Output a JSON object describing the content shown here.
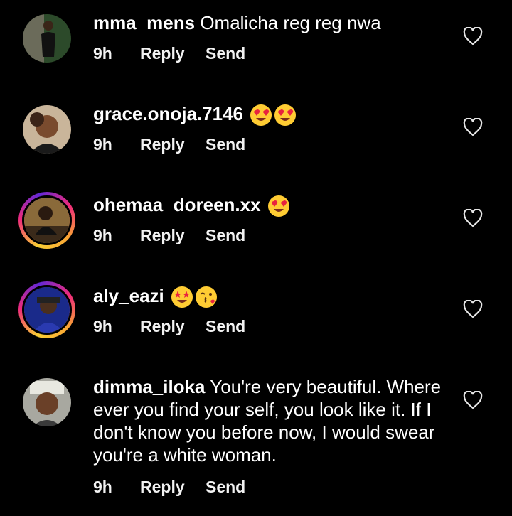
{
  "comments": [
    {
      "username": "mma_mens",
      "text": "Omalicha reg reg nwa",
      "time": "9h",
      "reply": "Reply",
      "send": "Send",
      "emoji": []
    },
    {
      "username": "grace.onoja.7146",
      "text": "",
      "time": "9h",
      "reply": "Reply",
      "send": "Send",
      "emoji": [
        "heart-eyes",
        "heart-eyes"
      ]
    },
    {
      "username": "ohemaa_doreen.xx",
      "text": "",
      "time": "9h",
      "reply": "Reply",
      "send": "Send",
      "emoji": [
        "heart-eyes"
      ]
    },
    {
      "username": "aly_eazi",
      "text": "",
      "time": "9h",
      "reply": "Reply",
      "send": "Send",
      "emoji": [
        "star-struck",
        "kissing-heart"
      ]
    },
    {
      "username": "dimma_iloka",
      "text": "You're very beautiful. Where ever you find your self, you look like it. If I don't know you before now, I would swear you're a white woman.",
      "time": "9h",
      "reply": "Reply",
      "send": "Send",
      "emoji": []
    }
  ],
  "colors": {
    "background": "#000000",
    "text": "#ffffff",
    "story_ring_start": "#f9ce34",
    "story_ring_mid": "#ee2a7b"
  }
}
